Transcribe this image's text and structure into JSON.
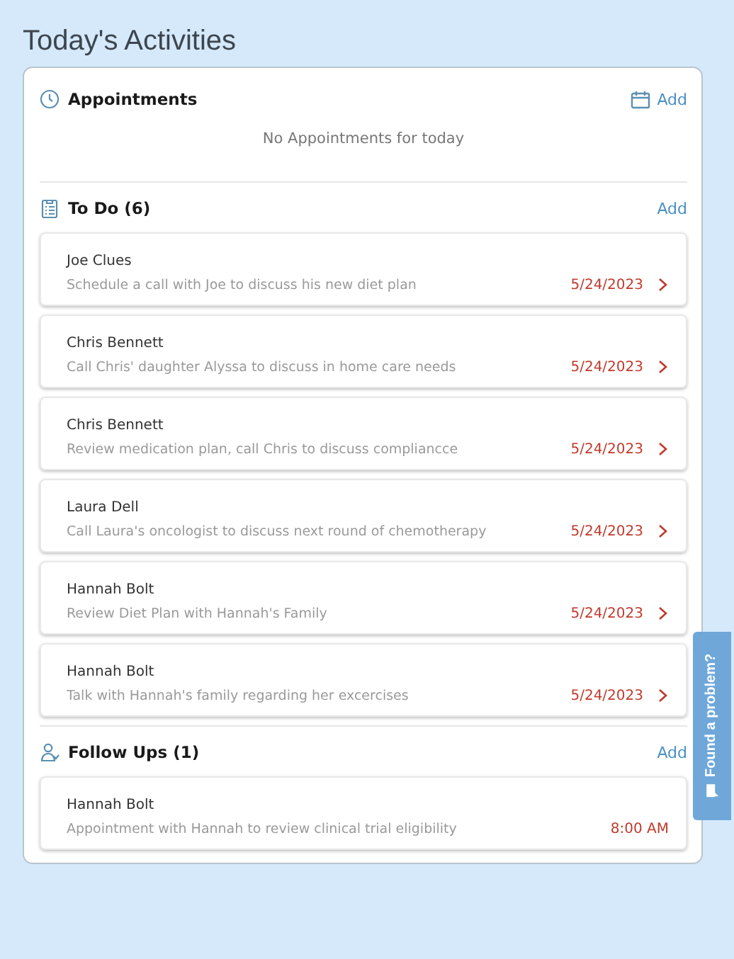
{
  "title": "Today's Activities",
  "sections": [
    {
      "kind": "appointments",
      "heading": "Appointments",
      "add_label": "Add",
      "empty_text": "No Appointments for today"
    },
    {
      "kind": "todo",
      "heading": "To Do (6)",
      "add_label": "Add",
      "items": [
        {
          "kind": "task",
          "name": "Joe Clues",
          "description": "Schedule a call with Joe to discuss his new diet plan",
          "due": "5/24/2023"
        },
        {
          "kind": "task",
          "name": "Chris Bennett",
          "description": "Call Chris' daughter Alyssa to discuss in home care needs",
          "due": "5/24/2023"
        },
        {
          "kind": "task",
          "name": "Chris Bennett",
          "description": "Review medication plan, call Chris to discuss compliancce",
          "due": "5/24/2023"
        },
        {
          "kind": "task",
          "name": "Laura Dell",
          "description": "Call Laura's oncologist to discuss next round of chemotherapy",
          "due": "5/24/2023"
        },
        {
          "kind": "task",
          "name": "Hannah Bolt",
          "description": "Review Diet Plan with Hannah's Family",
          "due": "5/24/2023"
        },
        {
          "kind": "task",
          "name": "Hannah Bolt",
          "description": "Talk with Hannah's family regarding her excercises",
          "due": "5/24/2023"
        }
      ]
    },
    {
      "kind": "followups",
      "heading": "Follow Ups (1)",
      "add_label": "Add",
      "items": [
        {
          "kind": "followup",
          "name": "Hannah Bolt",
          "description": "Appointment with Hannah to review clinical trial eligibility",
          "due": "8:00 AM"
        }
      ]
    }
  ],
  "feedback_tab": {
    "label": "Found a problem?"
  }
}
